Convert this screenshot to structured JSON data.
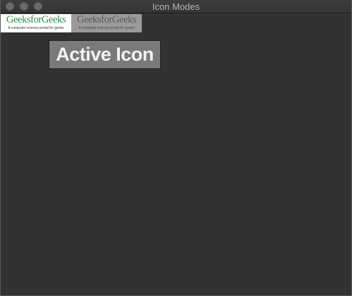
{
  "window": {
    "title": "Icon Modes"
  },
  "icons": {
    "normal": {
      "logo_text": "GeeksforGeeks",
      "tagline": "A computer science portal for geeks"
    },
    "disabled": {
      "logo_text": "GeeksforGeeks",
      "tagline": "A computer science portal for geeks"
    },
    "active": {
      "label": "Active Icon"
    }
  },
  "colors": {
    "background": "#323232",
    "brand_green": "#2f8d46",
    "active_fill": "#7a7a7a"
  }
}
